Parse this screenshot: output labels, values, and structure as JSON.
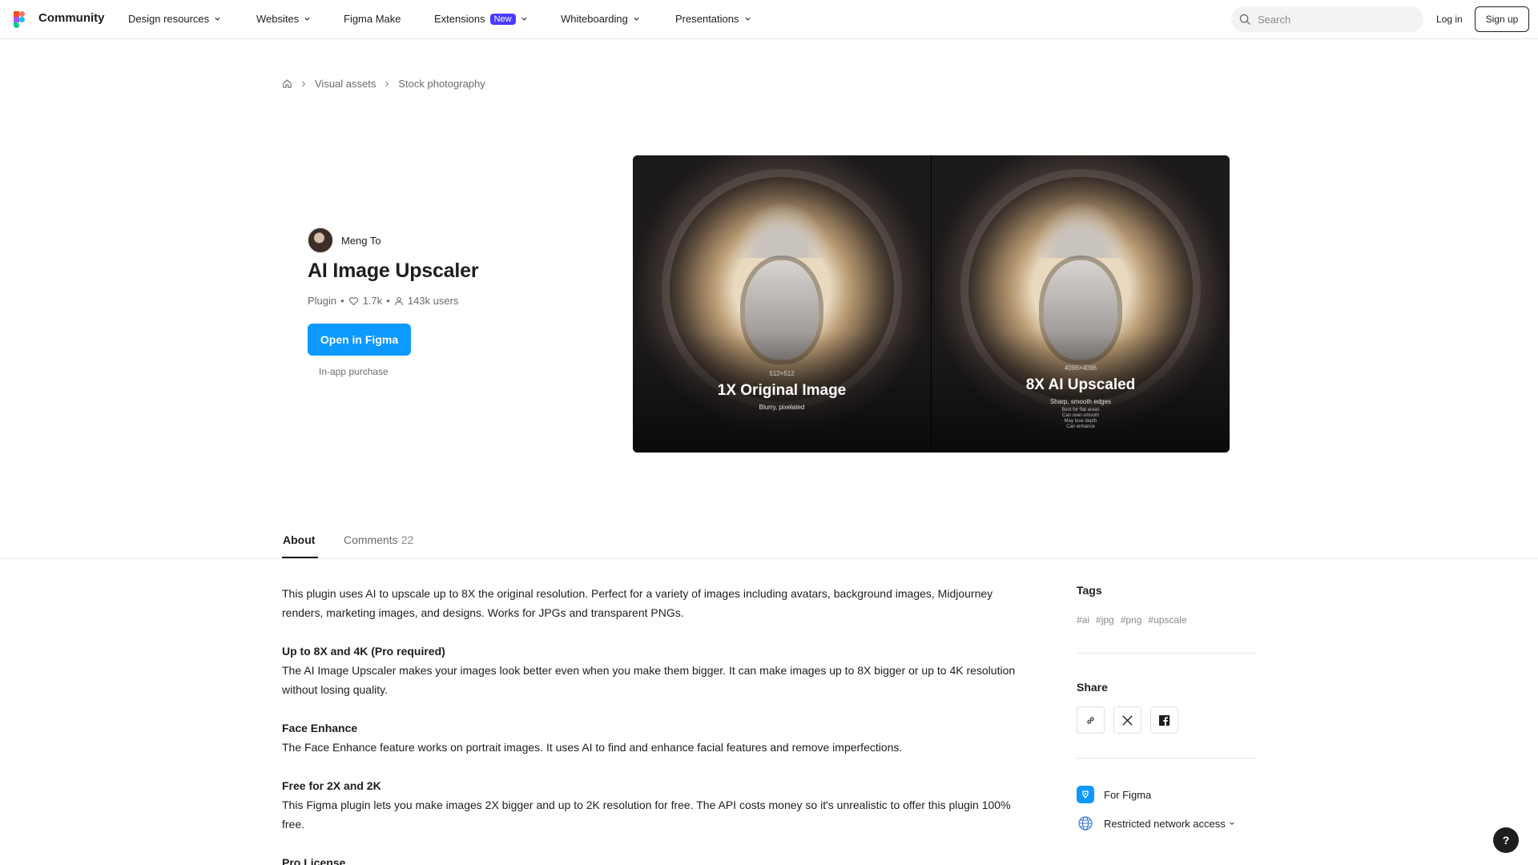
{
  "nav": {
    "brand": "Community",
    "items": [
      {
        "label": "Design resources"
      },
      {
        "label": "Websites"
      },
      {
        "label": "Figma Make"
      },
      {
        "label": "Extensions",
        "badge": "New"
      },
      {
        "label": "Whiteboarding"
      },
      {
        "label": "Presentations"
      }
    ],
    "search_placeholder": "Search",
    "login": "Log in",
    "signup": "Sign up"
  },
  "breadcrumb": [
    "Visual assets",
    "Stock photography"
  ],
  "resource": {
    "author": "Meng To",
    "title": "AI Image Upscaler",
    "type": "Plugin",
    "likes": "1.7k",
    "users": "143k users",
    "open_button": "Open in Figma",
    "purchase_note": "In-app purchase"
  },
  "preview": {
    "left": {
      "res": "512×512",
      "big": "1X Original Image",
      "small": "Blurry, pixelated"
    },
    "right": {
      "res": "4096×4096",
      "big": "8X AI Upscaled",
      "small": "Sharp, smooth edges",
      "bullets": [
        "Best for flat areas",
        "Can over-smooth",
        "May lose depth",
        "Can enhance"
      ]
    }
  },
  "tabs": {
    "about": "About",
    "comments": "Comments",
    "comments_count": "22"
  },
  "description": {
    "intro": "This plugin uses AI to upscale up to 8X the original resolution. Perfect for a variety of images including avatars, background images, Midjourney renders, marketing images, and designs. Works for JPGs and transparent PNGs.",
    "sections": [
      {
        "heading": "Up to 8X and 4K (Pro required)",
        "body": "The AI Image Upscaler makes your images look better even when you make them bigger. It can make images up to 8X bigger or up to 4K resolution without losing quality."
      },
      {
        "heading": "Face Enhance",
        "body": "The Face Enhance feature works on portrait images. It uses AI to find and enhance facial features and remove imperfections."
      },
      {
        "heading": "Free for 2X and 2K",
        "body": "This Figma plugin lets you make images 2X bigger and up to 2K resolution for free. The API costs money so it's unrealistic to offer this plugin 100% free."
      },
      {
        "heading": "Pro License",
        "body": ""
      }
    ]
  },
  "sidebar": {
    "tags_title": "Tags",
    "tags": [
      "#ai",
      "#jpg",
      "#png",
      "#upscale"
    ],
    "share_title": "Share",
    "for_figma": "For Figma",
    "network": "Restricted network access"
  },
  "help": "?"
}
